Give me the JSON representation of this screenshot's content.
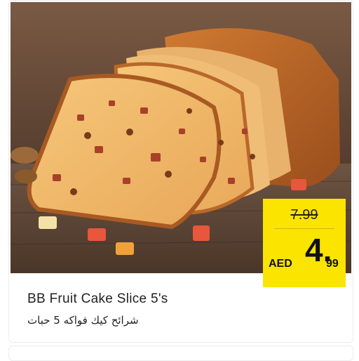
{
  "product": {
    "image_alt": "BB Fruit Cake Slice 5's",
    "title_en": "BB Fruit Cake Slice 5's",
    "title_ar": "شرائح كيك فواكه 5 حبات"
  },
  "price": {
    "old": "7.99",
    "currency": "AED",
    "new_int": "4.",
    "new_dec": "99"
  },
  "colors": {
    "tag_bg": "#fbe400",
    "text": "#222222"
  }
}
